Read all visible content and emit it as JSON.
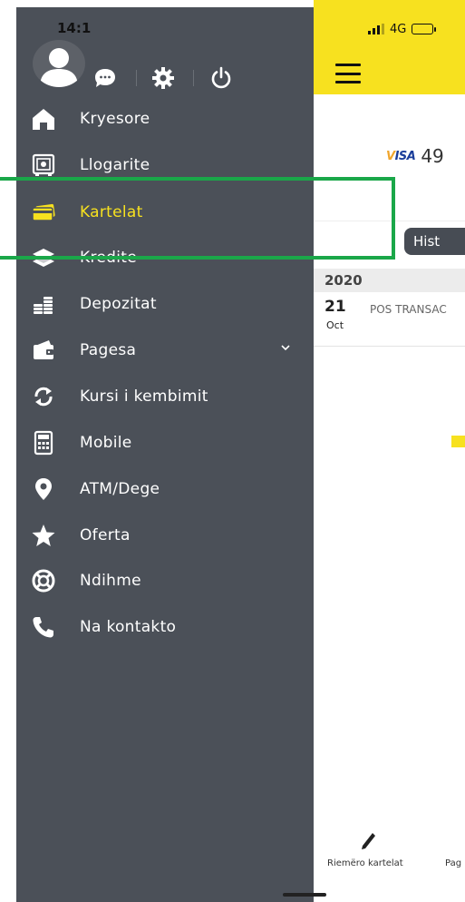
{
  "status_bar": {
    "time": "14:1",
    "network": "4G"
  },
  "drawer": {
    "menu_items": [
      {
        "label": "Kryesore",
        "icon": "home-icon"
      },
      {
        "label": "Llogarite",
        "icon": "safe-icon"
      },
      {
        "label": "Kartelat",
        "icon": "card-icon",
        "active": true
      },
      {
        "label": "Kredite",
        "icon": "money-stack-icon"
      },
      {
        "label": "Depozitat",
        "icon": "coins-icon"
      },
      {
        "label": "Pagesa",
        "icon": "wallet-icon",
        "has_submenu": true
      },
      {
        "label": "Kursi i kembimit",
        "icon": "exchange-icon"
      },
      {
        "label": "Mobile",
        "icon": "calculator-icon"
      },
      {
        "label": "ATM/Dege",
        "icon": "location-pin-icon"
      },
      {
        "label": "Oferta",
        "icon": "star-icon"
      },
      {
        "label": "Ndihme",
        "icon": "lifebuoy-icon"
      },
      {
        "label": "Na kontakto",
        "icon": "phone-icon"
      }
    ]
  },
  "app": {
    "card_brand": "VISA",
    "card_number_partial": "49",
    "history_tab": "Hist",
    "year": "2020",
    "transaction": {
      "day": "21",
      "month": "Oct",
      "description": "POS TRANSAC"
    },
    "bottom_actions": {
      "rename_label": "Riemëro kartelat",
      "pay_label": "Pag"
    }
  },
  "colors": {
    "drawer_bg": "#4b5058",
    "accent_yellow": "#f7e11f",
    "highlight_green": "#1aa749"
  }
}
